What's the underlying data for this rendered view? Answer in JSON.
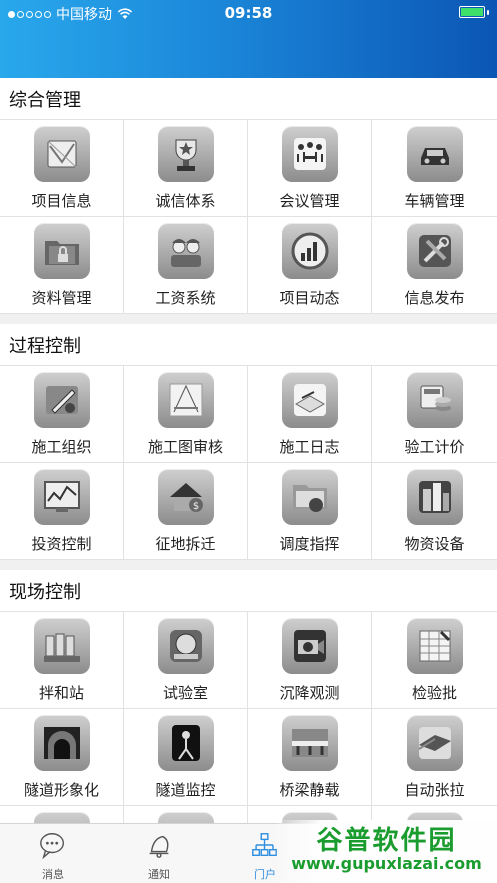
{
  "status_bar": {
    "carrier": "中国移动",
    "time": "09:58"
  },
  "sections": [
    {
      "title": "综合管理",
      "items": [
        {
          "label": "项目信息",
          "icon": "project-map-icon"
        },
        {
          "label": "诚信体系",
          "icon": "trophy-icon"
        },
        {
          "label": "会议管理",
          "icon": "meeting-icon"
        },
        {
          "label": "车辆管理",
          "icon": "car-icon"
        },
        {
          "label": "资料管理",
          "icon": "locked-folder-icon"
        },
        {
          "label": "工资系统",
          "icon": "workers-icon"
        },
        {
          "label": "项目动态",
          "icon": "bar-gauge-icon"
        },
        {
          "label": "信息发布",
          "icon": "tools-icon"
        }
      ]
    },
    {
      "title": "过程控制",
      "items": [
        {
          "label": "施工组织",
          "icon": "pencil-ruler-icon"
        },
        {
          "label": "施工图审核",
          "icon": "drafting-icon"
        },
        {
          "label": "施工日志",
          "icon": "open-book-icon"
        },
        {
          "label": "验工计价",
          "icon": "calculator-coins-icon"
        },
        {
          "label": "投资控制",
          "icon": "monitor-chart-icon"
        },
        {
          "label": "征地拆迁",
          "icon": "house-money-icon"
        },
        {
          "label": "调度指挥",
          "icon": "folder-globe-icon"
        },
        {
          "label": "物资设备",
          "icon": "buildings-icon"
        }
      ]
    },
    {
      "title": "现场控制",
      "items": [
        {
          "label": "拌和站",
          "icon": "silos-icon"
        },
        {
          "label": "试验室",
          "icon": "instrument-icon"
        },
        {
          "label": "沉降观测",
          "icon": "camera-icon"
        },
        {
          "label": "检验批",
          "icon": "spreadsheet-icon"
        },
        {
          "label": "隧道形象化",
          "icon": "tunnel-icon"
        },
        {
          "label": "隧道监控",
          "icon": "surveyor-icon"
        },
        {
          "label": "桥梁静载",
          "icon": "bridge-icon"
        },
        {
          "label": "自动张拉",
          "icon": "steel-beam-icon"
        },
        {
          "label": "",
          "icon": "partial-icon"
        },
        {
          "label": "",
          "icon": "partial-icon"
        },
        {
          "label": "",
          "icon": "partial-icon"
        },
        {
          "label": "",
          "icon": "partial-icon"
        }
      ]
    }
  ],
  "tabs": [
    {
      "label": "消息",
      "icon": "chat-bubble-icon",
      "active": false
    },
    {
      "label": "通知",
      "icon": "bell-icon",
      "active": false
    },
    {
      "label": "门户",
      "icon": "org-chart-icon",
      "active": true
    }
  ],
  "watermark": {
    "title": "谷普软件园",
    "url": "www.gupuxlazai.com"
  },
  "colors": {
    "header_start": "#29a8ec",
    "header_end": "#0b56b4",
    "active_tab": "#2e8ee0",
    "watermark": "#1a9c2e"
  }
}
